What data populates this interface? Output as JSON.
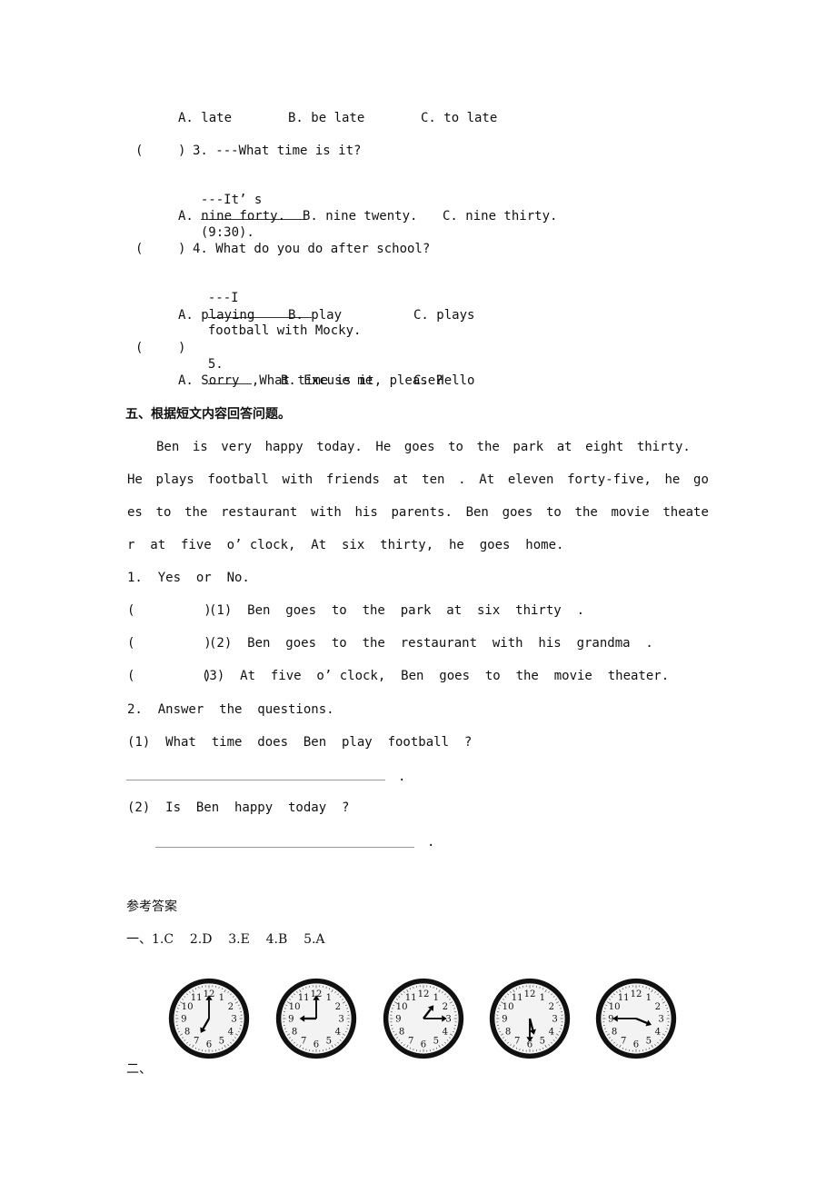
{
  "q2_options": {
    "a": "A. late",
    "b": "B. be late",
    "c": "C. to late"
  },
  "q3": {
    "paren_open": "(",
    "paren_close": ")",
    "stem": "3. ---What time is it?",
    "reply_prefix": "---It’ s",
    "reply_suffix": "(9:30).",
    "options": {
      "a": "A. nine forty.",
      "b": "B. nine twenty.",
      "c": "C. nine thirty."
    }
  },
  "q4": {
    "paren_open": "(",
    "paren_close": ")",
    "stem": "4. What do you do after school?",
    "reply_prefix": "---I",
    "reply_suffix": "football with Mocky.",
    "options": {
      "a": "A. playing",
      "b": "B. play",
      "c": "C. plays"
    }
  },
  "q5": {
    "paren_open": "(",
    "paren_close": ")",
    "stem_num": "5.",
    "stem_suffix": ",What time is it, please?",
    "options": {
      "a": "A. Sorry",
      "b": "B. Excuse me",
      "c": "C. Hello"
    }
  },
  "section5": {
    "title": "五、根据短文内容回答问题。",
    "passage_lines": [
      [
        "Ben",
        "is",
        "very",
        "happy",
        "today.",
        "He",
        "goes",
        "to",
        "the",
        "park",
        "at",
        "eight",
        "thirty."
      ],
      [
        "He",
        "plays",
        "football",
        "with",
        "friends",
        "at",
        "ten",
        ".",
        "At",
        "eleven",
        "forty-five,",
        "he",
        "go"
      ],
      [
        "es",
        "to",
        "the",
        "restaurant",
        "with",
        "his",
        "parents.",
        "Ben",
        "goes",
        "to",
        "the",
        "movie",
        "theate"
      ],
      "r  at  five  o’ clock,  At  six  thirty,  he  goes  home."
    ],
    "part1_title": "1.  Yes  or  No.",
    "yes_no": [
      {
        "paren": "(         )",
        "text": "(1)  Ben  goes  to  the  park  at  six  thirty  ."
      },
      {
        "paren": "(         )",
        "text": "(2)  Ben  goes  to  the  restaurant  with  his  grandma  ."
      },
      {
        "paren": "(         )",
        "text": "(3)  At  five  o’ clock,  Ben  goes  to  the  movie  theater."
      }
    ],
    "part2_title": "2.  Answer  the  questions.",
    "questions": [
      {
        "text": "(1)  What  time  does  Ben  play  football  ?",
        "answer_end": "."
      },
      {
        "text": "(2)  Is  Ben  happy  today  ?",
        "answer_end": "."
      }
    ]
  },
  "answers": {
    "title": "参考答案",
    "part1": "一、1.C    2.D    3.E    4.B    5.A",
    "part2_label": "二、",
    "clocks": [
      {
        "hour": 7,
        "minute": 0
      },
      {
        "hour": 9,
        "minute": 0
      },
      {
        "hour": 1,
        "minute": 15
      },
      {
        "hour": 5,
        "minute": 30
      },
      {
        "hour": 3,
        "minute": 45
      }
    ]
  }
}
